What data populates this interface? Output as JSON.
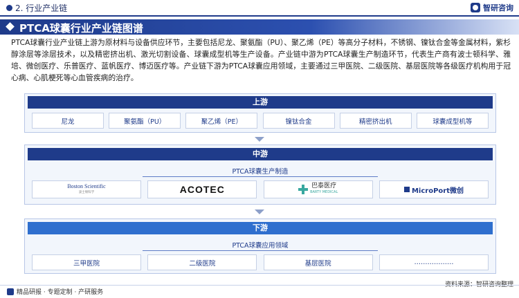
{
  "header": {
    "section_label": "2. 行业产业链",
    "brand_name": "智研咨询"
  },
  "title": "PTCA球囊行业产业链图谱",
  "intro": "PTCA球囊行业产业链上游为原材料与设备供应环节，主要包括尼龙、聚氨酯（PU）、聚乙烯（PE）等高分子材料，不锈钢、镍钛合金等金属材料，紫杉醇涂层等涂层技术，以及精密挤出机、激光切割设备、球囊成型机等生产设备。产业链中游为PTCA球囊生产制造环节，代表生产商有波士顿科学、雅培、微创医疗、乐普医疗、蓝帆医疗、博迈医疗等。产业链下游为PTCA球囊应用领域，主要通过三甲医院、二级医院、基层医院等各级医疗机构用于冠心病、心肌梗死等心血管疾病的治疗。",
  "upstream": {
    "label": "上游",
    "items": [
      "尼龙",
      "聚氨酯（PU）",
      "聚乙烯（PE）",
      "镍钛合金",
      "精密挤出机",
      "球囊成型机等"
    ]
  },
  "midstream": {
    "label": "中游",
    "subtitle": "PTCA球囊生产制造",
    "logos": [
      {
        "name": "Boston Scientific",
        "sub": "波士顿科学"
      },
      {
        "name": "ACOTEC"
      },
      {
        "name": "巴泰医疗",
        "sub": "BARTY MEDICAL"
      },
      {
        "name": "MicroPort微创"
      }
    ]
  },
  "downstream": {
    "label": "下游",
    "subtitle": "PTCA球囊应用领域",
    "items": [
      "三甲医院",
      "二级医院",
      "基层医院",
      "………………"
    ]
  },
  "footer": {
    "left": "精品研报 · 专题定制 · 产研服务",
    "source": "资料来源：智研咨询整理"
  },
  "colors": {
    "primary": "#1f3b8a",
    "accent": "#2f6fce",
    "panel_bg": "#f2f6fc"
  }
}
